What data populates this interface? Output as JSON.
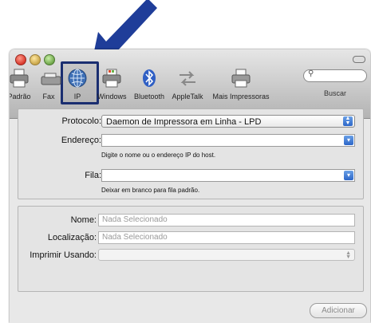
{
  "toolbar": {
    "items": [
      {
        "label": "Padrão",
        "icon": "printer-icon"
      },
      {
        "label": "Fax",
        "icon": "fax-icon"
      },
      {
        "label": "IP",
        "icon": "globe-icon"
      },
      {
        "label": "Windows",
        "icon": "windows-printer-icon"
      },
      {
        "label": "Bluetooth",
        "icon": "bluetooth-icon"
      },
      {
        "label": "AppleTalk",
        "icon": "appletalk-icon"
      },
      {
        "label": "Mais Impressoras",
        "icon": "printer-icon"
      }
    ],
    "search_label": "Buscar",
    "selected": "IP"
  },
  "connection": {
    "protocol_label": "Protocolo:",
    "protocol_value": "Daemon de Impressora em Linha - LPD",
    "address_label": "Endereço:",
    "address_value": "",
    "address_hint": "Digite o nome ou o endereço IP do host.",
    "queue_label": "Fila:",
    "queue_value": "",
    "queue_hint": "Deixar em branco para fila padrão."
  },
  "details": {
    "name_label": "Nome:",
    "name_placeholder": "Nada Selecionado",
    "location_label": "Localização:",
    "location_placeholder": "Nada Selecionado",
    "print_using_label": "Imprimir Usando:",
    "print_using_value": ""
  },
  "add_button_label": "Adicionar",
  "colors": {
    "annotation_arrow": "#1f3d99",
    "selection_box": "#1a2e70",
    "accent": "#2c66c8"
  }
}
